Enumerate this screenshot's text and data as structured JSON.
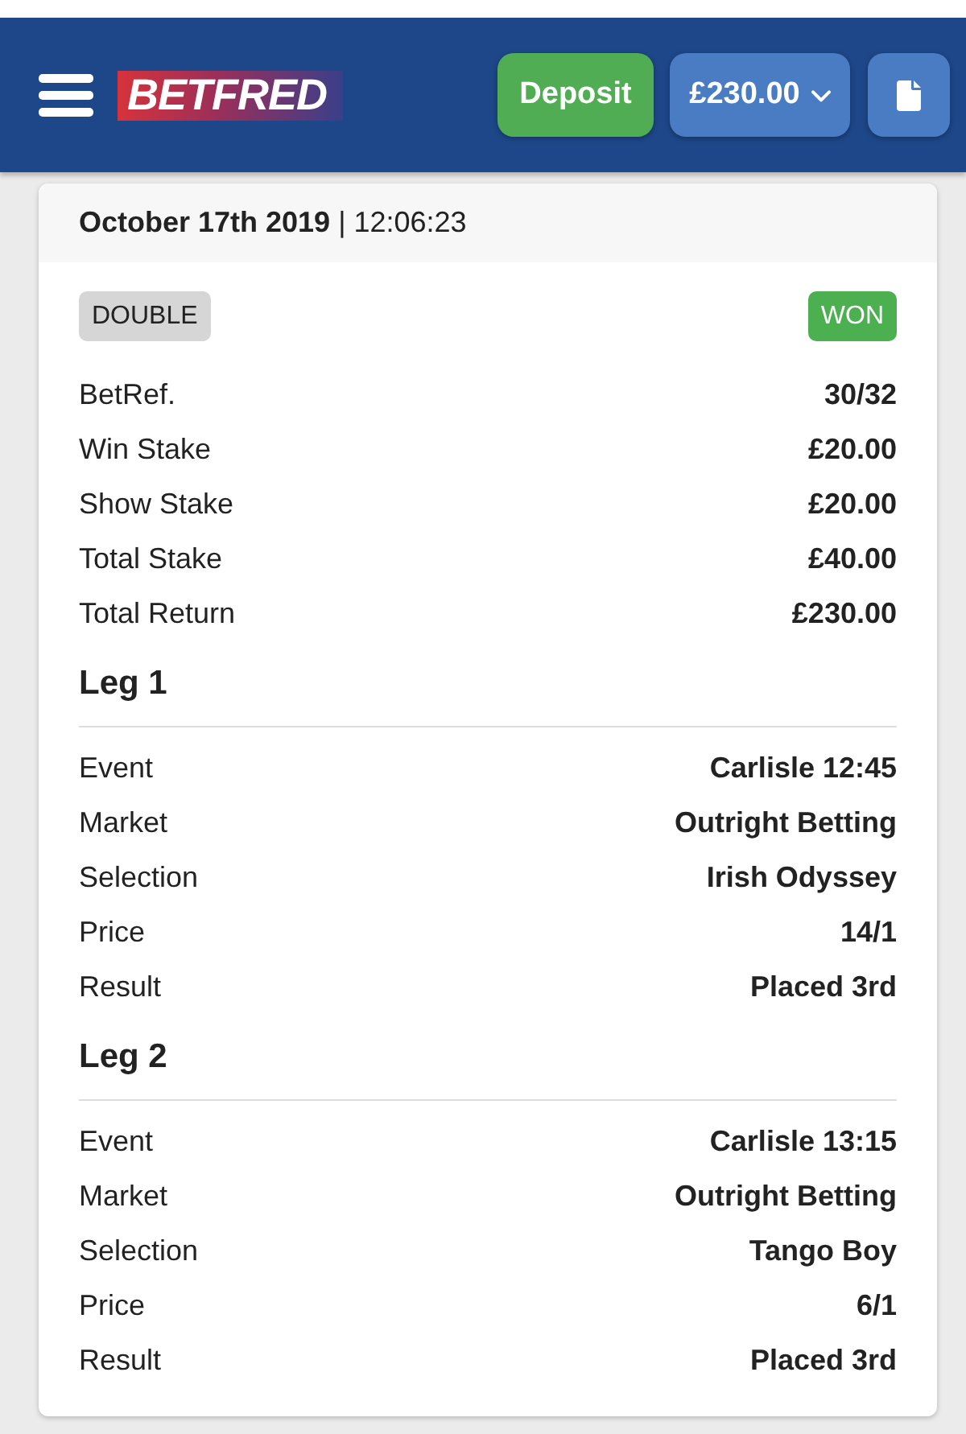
{
  "header": {
    "logo": "BETFRED",
    "deposit_button": "Deposit",
    "balance_button": "£230.00"
  },
  "bet": {
    "date_time": "**October 17th 2019** | 12:06:23",
    "badges": [
      {
        "kind": "type",
        "label": "DOUBLE"
      },
      {
        "kind": "status",
        "label": "WON"
      }
    ],
    "details": [
      {
        "label": "BetRef.",
        "value": "30/32"
      },
      {
        "label": "Win Stake",
        "value": "£20.00"
      },
      {
        "label": "Show Stake",
        "value": "£20.00"
      },
      {
        "label": "Total Stake",
        "value": "£40.00"
      },
      {
        "label": "Total Return",
        "value": "£230.00"
      }
    ],
    "legs": [
      {
        "title": "Leg 1",
        "details": [
          {
            "label": "Event",
            "value": "Carlisle 12:45"
          },
          {
            "label": "Market",
            "value": "Outright Betting"
          },
          {
            "label": "Selection",
            "value": "Irish Odyssey"
          },
          {
            "label": "Price",
            "value": "14/1"
          },
          {
            "label": "Result",
            "value": "Placed 3rd"
          }
        ]
      },
      {
        "title": "Leg 2",
        "details": [
          {
            "label": "Event",
            "value": "Carlisle 13:15"
          },
          {
            "label": "Market",
            "value": "Outright Betting"
          },
          {
            "label": "Selection",
            "value": "Tango Boy"
          },
          {
            "label": "Price",
            "value": "6/1"
          },
          {
            "label": "Result",
            "value": "Placed 3rd"
          }
        ]
      }
    ]
  }
}
